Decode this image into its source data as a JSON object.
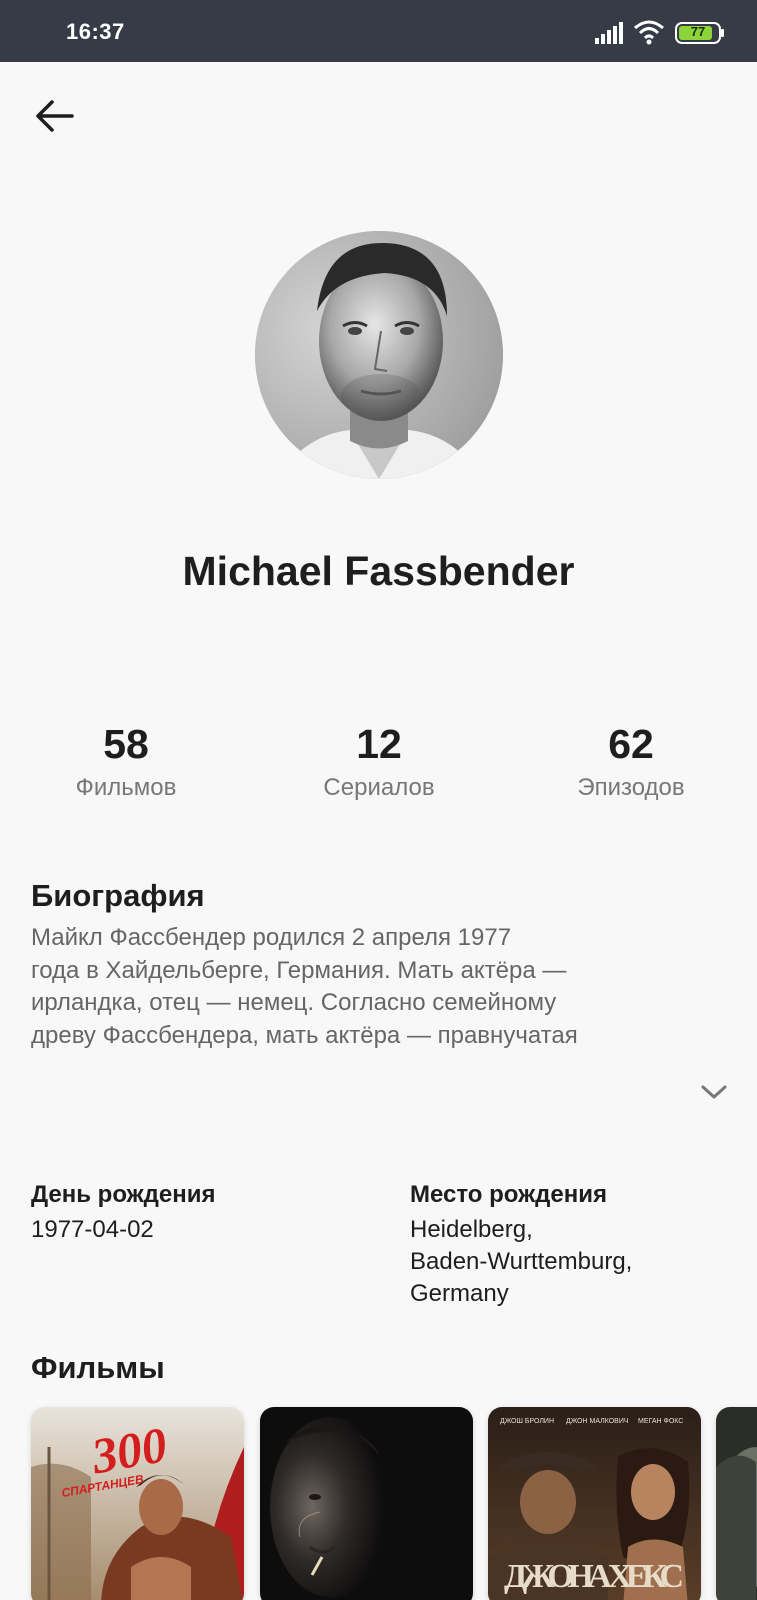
{
  "status_bar": {
    "time": "16:37",
    "battery": "77",
    "icons": [
      "signal-icon",
      "wifi-icon",
      "battery-icon"
    ]
  },
  "header": {
    "back_icon": "arrow-left-icon"
  },
  "actor": {
    "name": "Michael Fassbender"
  },
  "stats": [
    {
      "value": "58",
      "label": "Фильмов"
    },
    {
      "value": "12",
      "label": "Сериалов"
    },
    {
      "value": "62",
      "label": "Эпизодов"
    }
  ],
  "biography": {
    "title": "Биография",
    "lines": [
      "Майкл Фассбендер родился 2 апреля 1977",
      "года в Хайдельберге, Германия. Мать актёра —",
      "ирландка, отец — немец. Согласно семейному",
      "древу Фассбендера, мать актёра — правнучатая"
    ],
    "expand_icon": "chevron-down-icon"
  },
  "facts": {
    "birthday": {
      "label": "День рождения",
      "value": "1977-04-02"
    },
    "birthplace": {
      "label": "Место рождения",
      "lines": [
        "Heidelberg,",
        "Baden-Wurttemburg,",
        "Germany"
      ]
    }
  },
  "films": {
    "title": "Фильмы",
    "posters": [
      {
        "title_art": "300",
        "subtitle_art": "СПАРТАНЦЕВ"
      },
      {
        "title_art": ""
      },
      {
        "credits_art": [
          "ДЖОШ БРОЛИН",
          "ДЖОН МАЛКОВИЧ",
          "МЕГАН ФОКС"
        ],
        "title_art": "ДЖОНА ХЕКС"
      },
      {
        "title_art": ""
      }
    ]
  },
  "colors": {
    "status_bar_bg": "#373b45",
    "background": "#f8f8f8",
    "battery_green": "#8bd53a",
    "text_primary": "#1e1e1e",
    "text_secondary": "#666666"
  }
}
